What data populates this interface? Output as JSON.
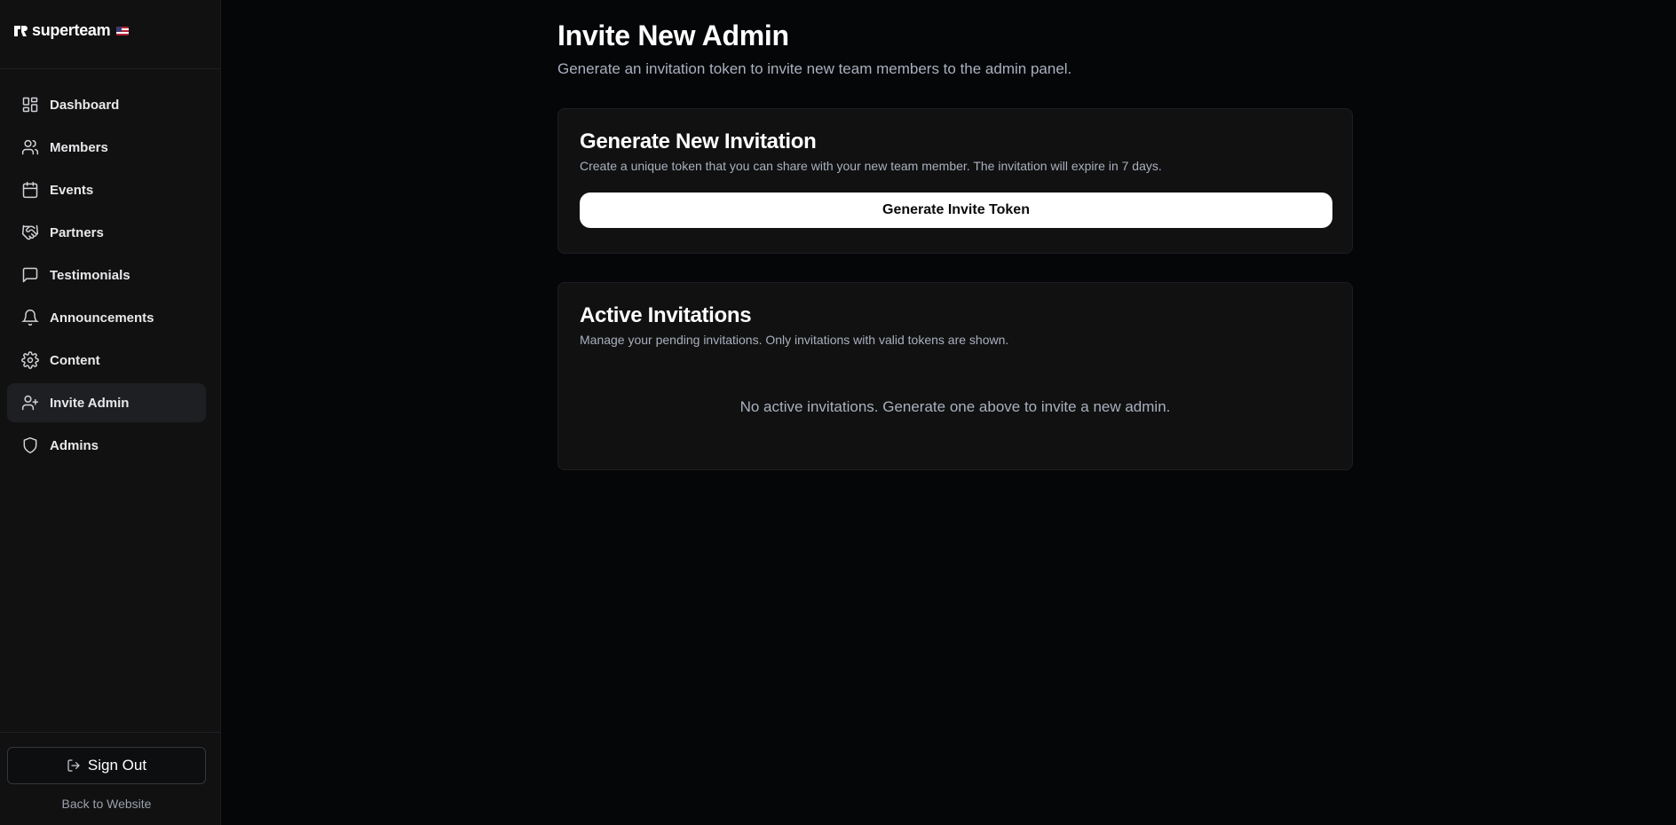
{
  "brand": {
    "name": "superteam"
  },
  "sidebar": {
    "items": [
      {
        "label": "Dashboard",
        "icon": "dashboard-icon"
      },
      {
        "label": "Members",
        "icon": "users-icon"
      },
      {
        "label": "Events",
        "icon": "calendar-icon"
      },
      {
        "label": "Partners",
        "icon": "handshake-icon"
      },
      {
        "label": "Testimonials",
        "icon": "message-square-icon"
      },
      {
        "label": "Announcements",
        "icon": "bell-icon"
      },
      {
        "label": "Content",
        "icon": "gear-icon"
      },
      {
        "label": "Invite Admin",
        "icon": "user-plus-icon",
        "active": true
      },
      {
        "label": "Admins",
        "icon": "shield-icon"
      }
    ],
    "sign_out_label": "Sign Out",
    "back_label": "Back to Website"
  },
  "page": {
    "title": "Invite New Admin",
    "subtitle": "Generate an invitation token to invite new team members to the admin panel."
  },
  "generate_card": {
    "title": "Generate New Invitation",
    "description": "Create a unique token that you can share with your new team member. The invitation will expire in 7 days.",
    "button_label": "Generate Invite Token"
  },
  "active_card": {
    "title": "Active Invitations",
    "description": "Manage your pending invitations. Only invitations with valid tokens are shown.",
    "empty_message": "No active invitations. Generate one above to invite a new admin."
  },
  "colors": {
    "background": "#050608",
    "sidebar": "#111112",
    "card": "#111112",
    "muted_text": "#a9b0bd",
    "button_bg": "#ffffff",
    "active_nav": "#1e1f22"
  }
}
